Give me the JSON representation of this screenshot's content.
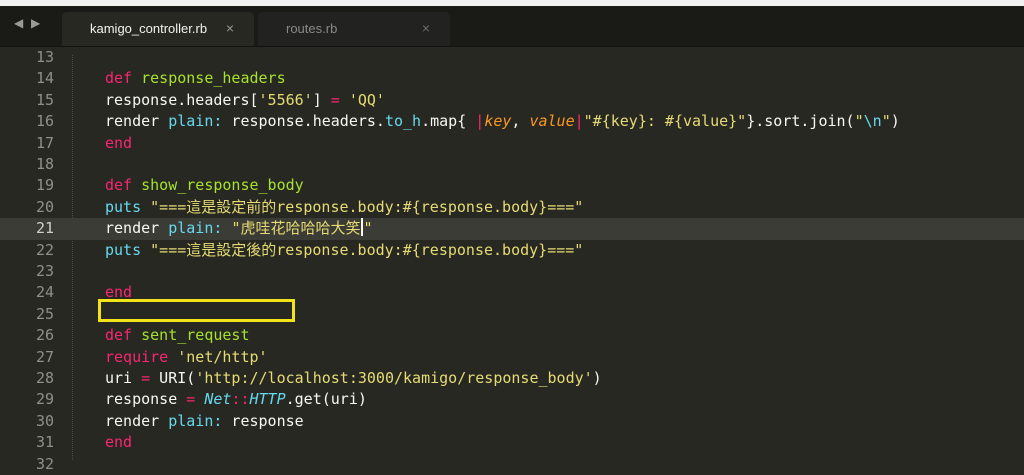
{
  "tabs": [
    {
      "label": "kamigo_controller.rb",
      "active": true,
      "close": "×"
    },
    {
      "label": "routes.rb",
      "active": false,
      "close": "×"
    }
  ],
  "nav_arrows": "◀ ▶",
  "current_line": 21,
  "lines": [
    {
      "n": "13",
      "tokens": []
    },
    {
      "n": "14",
      "tokens": [
        [
          "kw",
          "def"
        ],
        [
          "p",
          " "
        ],
        [
          "fn",
          "response_headers"
        ]
      ]
    },
    {
      "n": "15",
      "tokens": [
        [
          "p",
          "response.headers["
        ],
        [
          "str",
          "'5566'"
        ],
        [
          "p",
          "] "
        ],
        [
          "kw",
          "="
        ],
        [
          "p",
          " "
        ],
        [
          "str",
          "'QQ'"
        ]
      ]
    },
    {
      "n": "16",
      "tokens": [
        [
          "p",
          "render "
        ],
        [
          "sym",
          "plain:"
        ],
        [
          "p",
          " response.headers."
        ],
        [
          "sym",
          "to_h"
        ],
        [
          "p",
          ".map{ "
        ],
        [
          "kw",
          "|"
        ],
        [
          "ital",
          "key"
        ],
        [
          "p",
          ", "
        ],
        [
          "ital",
          "value"
        ],
        [
          "kw",
          "|"
        ],
        [
          "str",
          "\"#{key}: #{value}\""
        ],
        [
          "p",
          "}.sort.join("
        ],
        [
          "str",
          "\""
        ],
        [
          "sym",
          "\\n"
        ],
        [
          "str",
          "\""
        ],
        [
          "p",
          ")"
        ]
      ]
    },
    {
      "n": "17",
      "tokens": [
        [
          "kw",
          "end"
        ]
      ]
    },
    {
      "n": "18",
      "tokens": []
    },
    {
      "n": "19",
      "tokens": [
        [
          "kw",
          "def"
        ],
        [
          "p",
          " "
        ],
        [
          "fn",
          "show_response_body"
        ]
      ]
    },
    {
      "n": "20",
      "tokens": [
        [
          "sym",
          "puts"
        ],
        [
          "p",
          " "
        ],
        [
          "str",
          "\"===這是設定前的response.body:#{response.body}===\""
        ]
      ]
    },
    {
      "n": "21",
      "tokens": [
        [
          "p",
          "render "
        ],
        [
          "sym",
          "plain:"
        ],
        [
          "p",
          " "
        ],
        [
          "str",
          "\"虎哇花哈哈哈大笑"
        ],
        [
          "caret",
          ""
        ],
        [
          "str",
          "\""
        ]
      ]
    },
    {
      "n": "22",
      "tokens": [
        [
          "sym",
          "puts"
        ],
        [
          "p",
          " "
        ],
        [
          "str",
          "\"===這是設定後的response.body:#{response.body}===\""
        ]
      ]
    },
    {
      "n": "23",
      "tokens": []
    },
    {
      "n": "24",
      "tokens": [
        [
          "kw",
          "end"
        ]
      ]
    },
    {
      "n": "25",
      "tokens": []
    },
    {
      "n": "26",
      "tokens": [
        [
          "kw",
          "def"
        ],
        [
          "p",
          " "
        ],
        [
          "fn",
          "sent_request"
        ]
      ]
    },
    {
      "n": "27",
      "tokens": [
        [
          "kw",
          "require"
        ],
        [
          "p",
          " "
        ],
        [
          "str",
          "'net/http'"
        ]
      ]
    },
    {
      "n": "28",
      "tokens": [
        [
          "p",
          "uri "
        ],
        [
          "kw",
          "="
        ],
        [
          "p",
          " URI("
        ],
        [
          "str",
          "'http://localhost:3000/kamigo/response_body'"
        ],
        [
          "p",
          ")"
        ]
      ]
    },
    {
      "n": "29",
      "tokens": [
        [
          "p",
          "response "
        ],
        [
          "kw",
          "="
        ],
        [
          "p",
          " "
        ],
        [
          "cls",
          "Net"
        ],
        [
          "kw",
          "::"
        ],
        [
          "cls",
          "HTTP"
        ],
        [
          "p",
          ".get(uri)"
        ]
      ]
    },
    {
      "n": "30",
      "tokens": [
        [
          "p",
          "render "
        ],
        [
          "sym",
          "plain:"
        ],
        [
          "p",
          " response"
        ]
      ]
    },
    {
      "n": "31",
      "tokens": [
        [
          "kw",
          "end"
        ]
      ]
    },
    {
      "n": "32",
      "tokens": []
    }
  ],
  "colors": {
    "background": "#272822",
    "keyword": "#f92672",
    "function": "#a6e22e",
    "string": "#e6db74",
    "symbol": "#66d9ef",
    "highlight_box": "#f2e21a"
  }
}
